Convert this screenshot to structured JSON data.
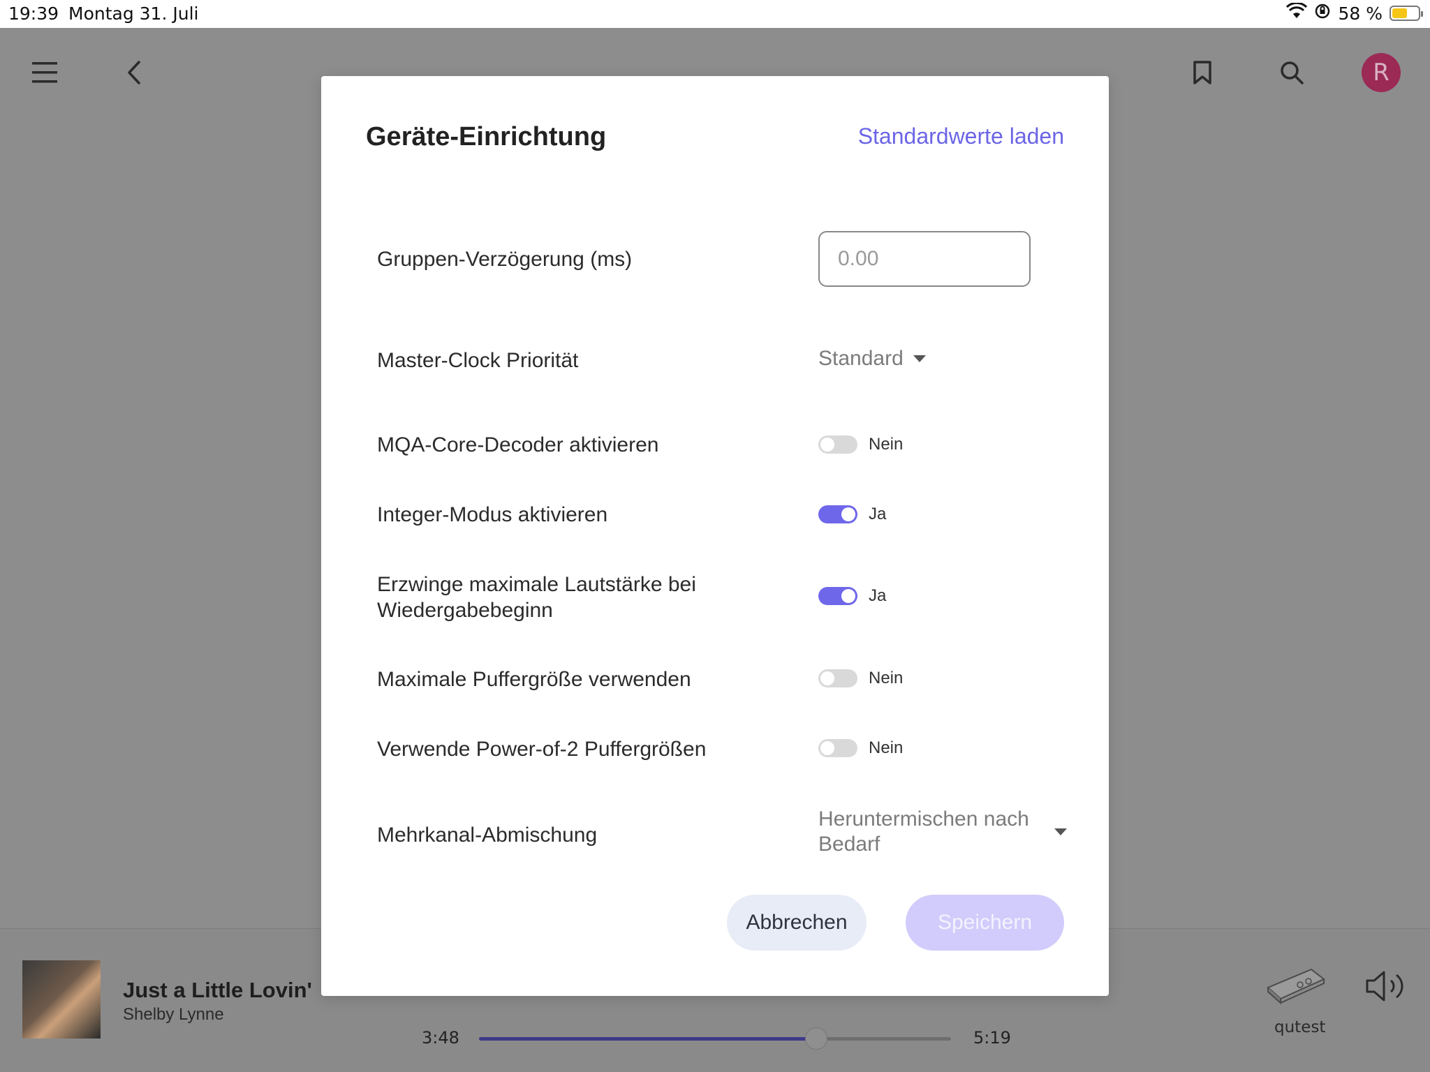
{
  "status_bar": {
    "time": "19:39",
    "date": "Montag 31. Juli",
    "battery_text": "58 %",
    "battery_level": 0.58,
    "battery_color": "#f5c518",
    "icons": [
      "wifi-icon",
      "orientation-lock-icon",
      "battery-icon"
    ]
  },
  "background_app": {
    "icons": [
      "hamburger-menu-icon",
      "back-chevron-icon",
      "bookmark-icon",
      "search-icon"
    ],
    "avatar_initial": "R",
    "avatar_color": "#9b2a55"
  },
  "player": {
    "title": "Just a Little Lovin'",
    "artist": "Shelby Lynne",
    "current_time": "3:48",
    "total_time": "5:19",
    "progress": 0.714,
    "accent": "#3d3a8a",
    "device_name": "qutest"
  },
  "dialog": {
    "title": "Geräte-Einrichtung",
    "defaults_link": "Standardwerte laden",
    "accent": "#6b65e6",
    "group_delay": {
      "label": "Gruppen-Verzögerung (ms)",
      "placeholder": "0.00",
      "value": ""
    },
    "master_clock": {
      "label": "Master-Clock Priorität",
      "selected": "Standard"
    },
    "toggles": [
      {
        "label": "MQA-Core-Decoder aktivieren",
        "on": false,
        "state_text": "Nein"
      },
      {
        "label": "Integer-Modus aktivieren",
        "on": true,
        "state_text": "Ja"
      },
      {
        "label": "Erzwinge maximale Lautstärke bei Wiedergabebeginn",
        "on": true,
        "state_text": "Ja"
      },
      {
        "label": "Maximale Puffergröße verwenden",
        "on": false,
        "state_text": "Nein"
      },
      {
        "label": "Verwende Power-of-2 Puffergrößen",
        "on": false,
        "state_text": "Nein"
      }
    ],
    "downmix": {
      "label": "Mehrkanal-Abmischung",
      "selected": "Heruntermischen nach Bedarf"
    },
    "cancel_label": "Abbrechen",
    "save_label": "Speichern"
  }
}
